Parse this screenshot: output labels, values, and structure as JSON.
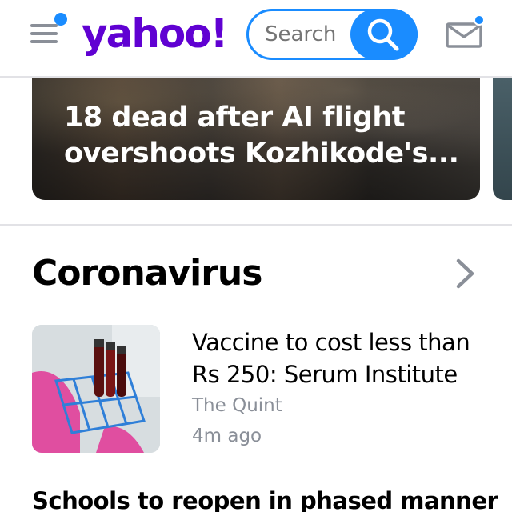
{
  "header": {
    "logo_text": "yahoo!",
    "search_placeholder": "Search",
    "menu_icon": "hamburger-menu-icon",
    "search_icon": "search-icon",
    "mail_icon": "mail-icon"
  },
  "hero": {
    "title": "18 dead after AI flight overshoots Kozhikode's..."
  },
  "section": {
    "title": "Coronavirus",
    "chevron_icon": "chevron-right-icon"
  },
  "stories": [
    {
      "title": "Vaccine to cost less than Rs 250: Serum Institute",
      "source": "The Quint",
      "time": "4m ago"
    },
    {
      "title": "Schools to reopen in phased manner"
    }
  ],
  "colors": {
    "brand": "#6001d2",
    "accent": "#1a8cff",
    "muted": "#8a8f98"
  }
}
